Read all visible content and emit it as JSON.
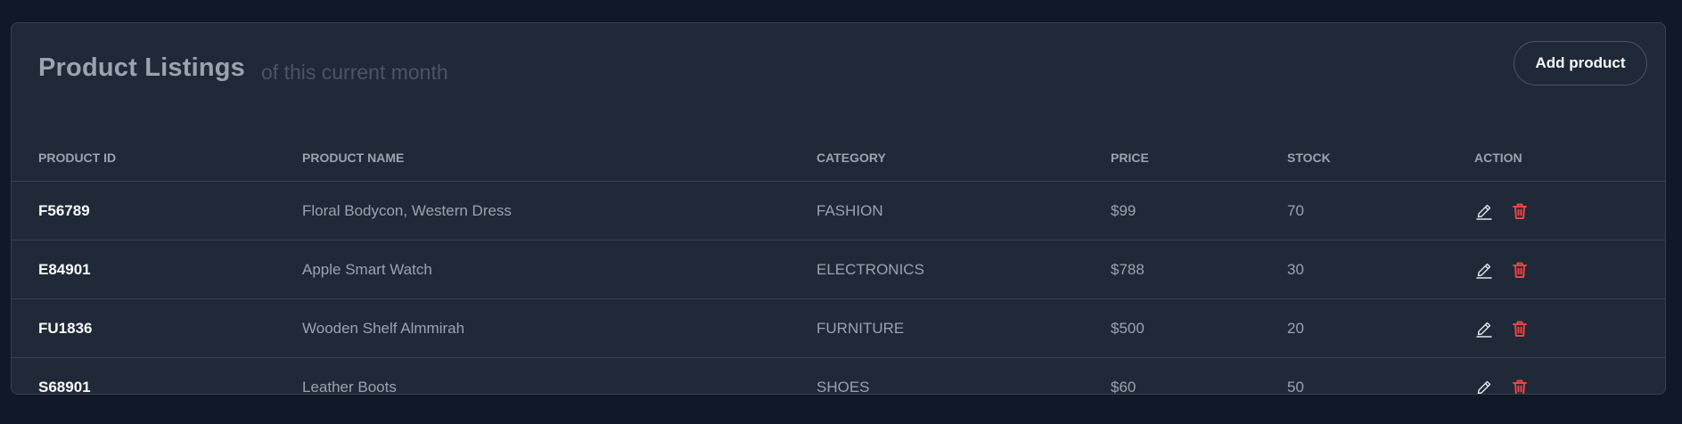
{
  "header": {
    "title": "Product Listings",
    "subtitle": "of this current month",
    "add_button": "Add product"
  },
  "columns": [
    "PRODUCT ID",
    "PRODUCT NAME",
    "CATEGORY",
    "PRICE",
    "STOCK",
    "ACTION"
  ],
  "rows": [
    {
      "id": "F56789",
      "name": "Floral Bodycon, Western Dress",
      "category": "FASHION",
      "price": "$99",
      "stock": "70"
    },
    {
      "id": "E84901",
      "name": "Apple Smart Watch",
      "category": "ELECTRONICS",
      "price": "$788",
      "stock": "30"
    },
    {
      "id": "FU1836",
      "name": "Wooden Shelf Almmirah",
      "category": "FURNITURE",
      "price": "$500",
      "stock": "20"
    },
    {
      "id": "S68901",
      "name": "Leather Boots",
      "category": "SHOES",
      "price": "$60",
      "stock": "50"
    }
  ],
  "icons": {
    "edit": "pencil-icon",
    "delete": "trash-icon"
  },
  "colors": {
    "page_bg": "#111827",
    "card_bg": "#1f2937",
    "delete": "#ef4444",
    "edit": "#e5e7eb"
  }
}
